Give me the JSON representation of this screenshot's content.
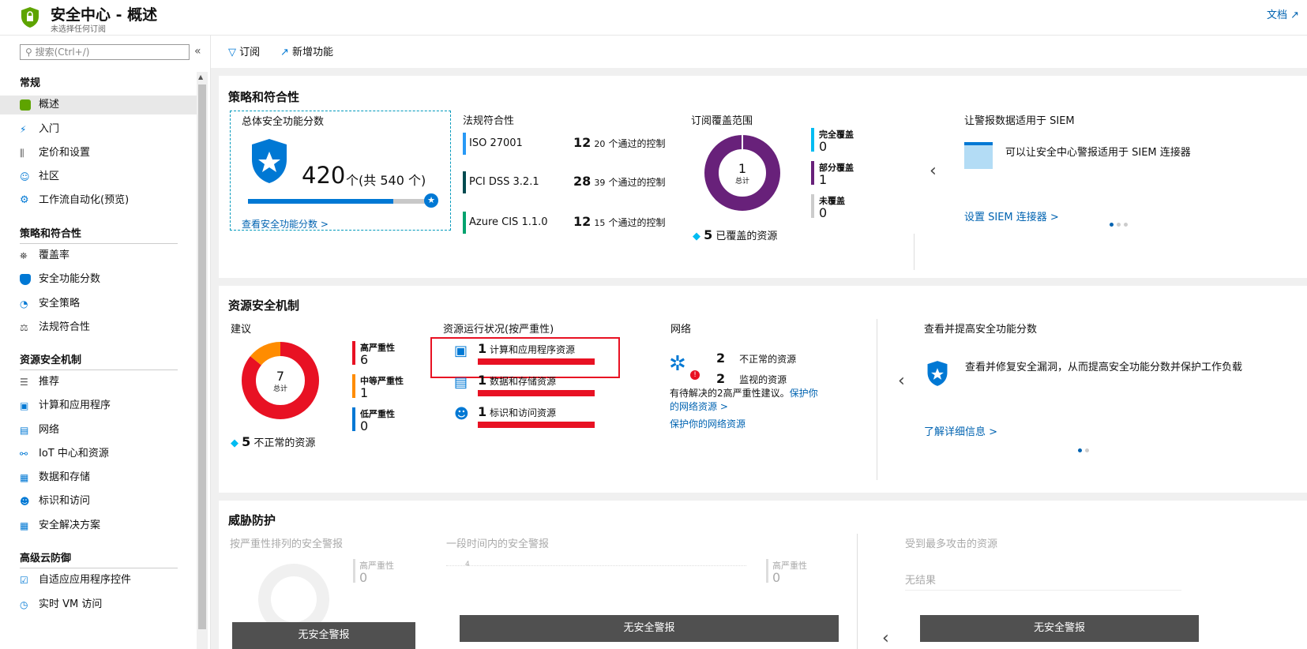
{
  "header": {
    "title": "安全中心 - 概述",
    "subtitle": "未选择任何订阅",
    "docs": "文档"
  },
  "sidebar": {
    "search_placeholder": "搜索(Ctrl+/)",
    "sections": [
      {
        "label": "常规",
        "items": [
          "概述",
          "入门",
          "定价和设置",
          "社区",
          "工作流自动化(预览)"
        ]
      },
      {
        "label": "策略和符合性",
        "items": [
          "覆盖率",
          "安全功能分数",
          "安全策略",
          "法规符合性"
        ]
      },
      {
        "label": "资源安全机制",
        "items": [
          "推荐",
          "计算和应用程序",
          "网络",
          "IoT 中心和资源",
          "数据和存储",
          "标识和访问",
          "安全解决方案"
        ]
      },
      {
        "label": "高级云防御",
        "items": [
          "自适应应用程序控件",
          "实时 VM 访问"
        ]
      }
    ]
  },
  "toolbar": {
    "subscribe": "订阅",
    "whats_new": "新增功能"
  },
  "policy": {
    "title": "策略和符合性",
    "score": {
      "heading": "总体安全功能分数",
      "value": "420",
      "unit": "个(共 540 个)",
      "progress": 0.78,
      "link": "查看安全功能分数 >"
    },
    "compliance": {
      "heading": "法规符合性",
      "rows": [
        {
          "name": "ISO 27001",
          "passed": "12",
          "total": "20",
          "suffix": "个通过的控制",
          "color": "#2899f5"
        },
        {
          "name": "PCI DSS 3.2.1",
          "passed": "28",
          "total": "39",
          "suffix": "个通过的控制",
          "color": "#004b50"
        },
        {
          "name": "Azure CIS 1.1.0",
          "passed": "12",
          "total": "15",
          "suffix": "个通过的控制",
          "color": "#00a36e"
        }
      ]
    },
    "coverage": {
      "heading": "订阅覆盖范围",
      "center": "1",
      "center_label": "总计",
      "resources": "5",
      "resources_label": "已覆盖的资源",
      "legend": [
        {
          "label": "完全覆盖",
          "value": "0",
          "color": "#00bcf2"
        },
        {
          "label": "部分覆盖",
          "value": "1",
          "color": "#68217a"
        },
        {
          "label": "未覆盖",
          "value": "0",
          "color": "#ccc"
        }
      ]
    },
    "siem": {
      "heading": "让警报数据适用于 SIEM",
      "text": "可以让安全中心警报适用于 SIEM 连接器",
      "link": "设置 SIEM 连接器 >"
    }
  },
  "resource": {
    "title": "资源安全机制",
    "recs": {
      "heading": "建议",
      "center": "7",
      "center_label": "总计",
      "resources": "5",
      "resources_label": "不正常的资源",
      "legend": [
        {
          "label": "高严重性",
          "value": "6",
          "color": "#e81123"
        },
        {
          "label": "中等严重性",
          "value": "1",
          "color": "#ff8c00"
        },
        {
          "label": "低严重性",
          "value": "0",
          "color": "#0078d4"
        }
      ]
    },
    "health": {
      "heading": "资源运行状况(按严重性)",
      "rows": [
        {
          "count": "1",
          "label": "计算和应用程序资源"
        },
        {
          "count": "1",
          "label": "数据和存储资源"
        },
        {
          "count": "1",
          "label": "标识和访问资源"
        }
      ]
    },
    "network": {
      "heading": "网络",
      "unhealthy": "2",
      "unhealthy_label": "不正常的资源",
      "monitored": "2",
      "monitored_label": "监视的资源",
      "note": "有待解决的2高严重性建议。",
      "note_link": "保护你的网络资源 >",
      "link": "保护你的网络资源"
    },
    "improve": {
      "heading": "查看并提高安全功能分数",
      "text": "查看并修复安全漏洞，从而提高安全功能分数并保护工作负载",
      "link": "了解详细信息 >"
    }
  },
  "threat": {
    "title": "威胁防护",
    "by_severity": "按严重性排列的安全警报",
    "over_time": "一段时间内的安全警报",
    "most_attacked": "受到最多攻击的资源",
    "high": "高严重性",
    "zero": "0",
    "axis_tick": "4",
    "no_results": "无结果",
    "no_alerts": "无安全警报"
  }
}
